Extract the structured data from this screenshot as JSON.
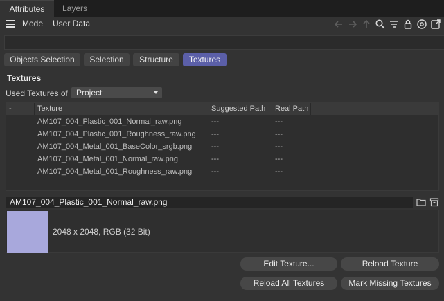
{
  "window": {
    "tabs": [
      "Attributes",
      "Layers"
    ],
    "active_tab": "Attributes"
  },
  "menubar": {
    "items": [
      "Mode",
      "User Data"
    ],
    "icons": [
      "arrow-left-icon",
      "arrow-right-icon",
      "arrow-up-icon",
      "search-icon",
      "filter-icon",
      "lock-icon",
      "target-icon",
      "new-window-icon"
    ]
  },
  "search": {
    "placeholder": ""
  },
  "subtabs": {
    "items": [
      "Objects Selection",
      "Selection",
      "Structure",
      "Textures"
    ],
    "active": "Textures"
  },
  "textures": {
    "title": "Textures",
    "used_label": "Used Textures of",
    "dropdown_value": "Project"
  },
  "table": {
    "columns": [
      "-",
      "Texture",
      "Suggested Path",
      "Real Path"
    ],
    "rows": [
      [
        "",
        "AM107_004_Plastic_001_Normal_raw.png",
        "---",
        "---"
      ],
      [
        "",
        "AM107_004_Plastic_001_Roughness_raw.png",
        "---",
        "---"
      ],
      [
        "",
        "AM107_004_Metal_001_BaseColor_srgb.png",
        "---",
        "---"
      ],
      [
        "",
        "AM107_004_Metal_001_Normal_raw.png",
        "---",
        "---"
      ],
      [
        "",
        "AM107_004_Metal_001_Roughness_raw.png",
        "---",
        "---"
      ]
    ]
  },
  "selected": {
    "path": "AM107_004_Plastic_001_Normal_raw.png",
    "info": "2048 x 2048, RGB (32 Bit)",
    "swatch_color": "#a8a8dc"
  },
  "buttons": {
    "edit": "Edit Texture...",
    "reload": "Reload Texture",
    "reload_all": "Reload All Textures",
    "mark_missing": "Mark Missing Textures"
  },
  "colors": {
    "accent": "#5b5fa8",
    "background": "#333333"
  }
}
